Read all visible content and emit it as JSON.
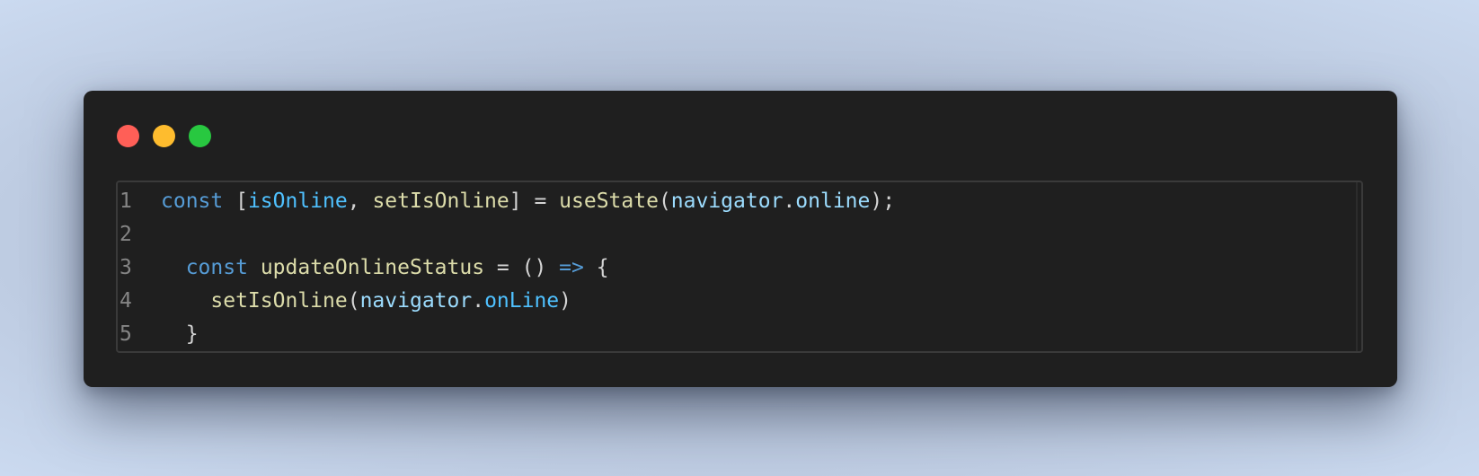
{
  "window": {
    "controls": [
      {
        "name": "close",
        "color": "#ff5f57"
      },
      {
        "name": "minimize",
        "color": "#febc2e"
      },
      {
        "name": "maximize",
        "color": "#28c840"
      }
    ]
  },
  "code": {
    "language": "javascript",
    "lines": [
      {
        "number": "1",
        "tokens": [
          {
            "text": "const",
            "kind": "kw"
          },
          {
            "text": " [",
            "kind": "punc"
          },
          {
            "text": "isOnline",
            "kind": "const"
          },
          {
            "text": ", ",
            "kind": "punc"
          },
          {
            "text": "setIsOnline",
            "kind": "fn"
          },
          {
            "text": "] = ",
            "kind": "punc"
          },
          {
            "text": "useState",
            "kind": "fn"
          },
          {
            "text": "(",
            "kind": "punc"
          },
          {
            "text": "navigator",
            "kind": "var"
          },
          {
            "text": ".",
            "kind": "punc"
          },
          {
            "text": "online",
            "kind": "var"
          },
          {
            "text": ");",
            "kind": "punc"
          }
        ]
      },
      {
        "number": "2",
        "tokens": []
      },
      {
        "number": "3",
        "tokens": [
          {
            "text": "  ",
            "kind": "punc"
          },
          {
            "text": "const",
            "kind": "kw"
          },
          {
            "text": " ",
            "kind": "punc"
          },
          {
            "text": "updateOnlineStatus",
            "kind": "fn"
          },
          {
            "text": " = () ",
            "kind": "punc"
          },
          {
            "text": "=>",
            "kind": "kw"
          },
          {
            "text": " {",
            "kind": "punc"
          }
        ]
      },
      {
        "number": "4",
        "tokens": [
          {
            "text": "    ",
            "kind": "punc"
          },
          {
            "text": "setIsOnline",
            "kind": "fn"
          },
          {
            "text": "(",
            "kind": "punc"
          },
          {
            "text": "navigator",
            "kind": "var"
          },
          {
            "text": ".",
            "kind": "punc"
          },
          {
            "text": "onLine",
            "kind": "const"
          },
          {
            "text": ")",
            "kind": "punc"
          }
        ]
      },
      {
        "number": "5",
        "tokens": [
          {
            "text": "  }",
            "kind": "punc"
          }
        ]
      }
    ]
  }
}
